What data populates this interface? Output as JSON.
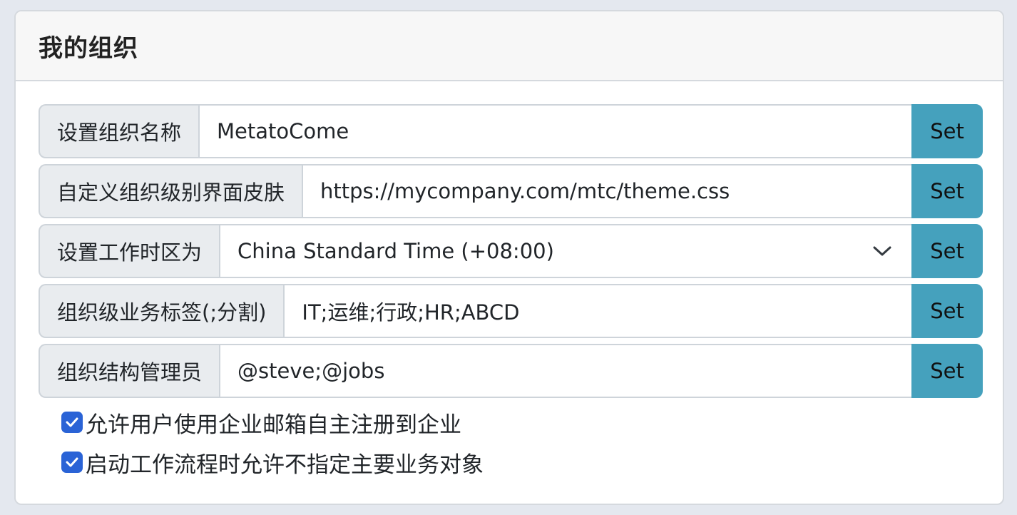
{
  "panel": {
    "title": "我的组织"
  },
  "settings": [
    {
      "label": "设置组织名称",
      "value": "MetatoCome",
      "button": "Set"
    },
    {
      "label": "自定义组织级别界面皮肤",
      "value": "https://mycompany.com/mtc/theme.css",
      "button": "Set"
    },
    {
      "label": "设置工作时区为",
      "value": "China Standard Time (+08:00)",
      "button": "Set",
      "control": "select"
    },
    {
      "label": "组织级业务标签(;分割)",
      "value": "IT;运维;行政;HR;ABCD",
      "button": "Set"
    },
    {
      "label": "组织结构管理员",
      "value": "@steve;@jobs",
      "button": "Set"
    }
  ],
  "options": [
    {
      "label": "允许用户使用企业邮箱自主注册到企业",
      "checked": true
    },
    {
      "label": "启动工作流程时允许不指定主要业务对象",
      "checked": true
    }
  ],
  "colors": {
    "button": "#45a1bd",
    "checkbox": "#2a63d6",
    "addon_background": "#e9ecef",
    "page_background": "#e4e8ef"
  },
  "icons": {
    "select_arrow": "chevron-down-icon",
    "checkbox_mark": "check-icon"
  }
}
